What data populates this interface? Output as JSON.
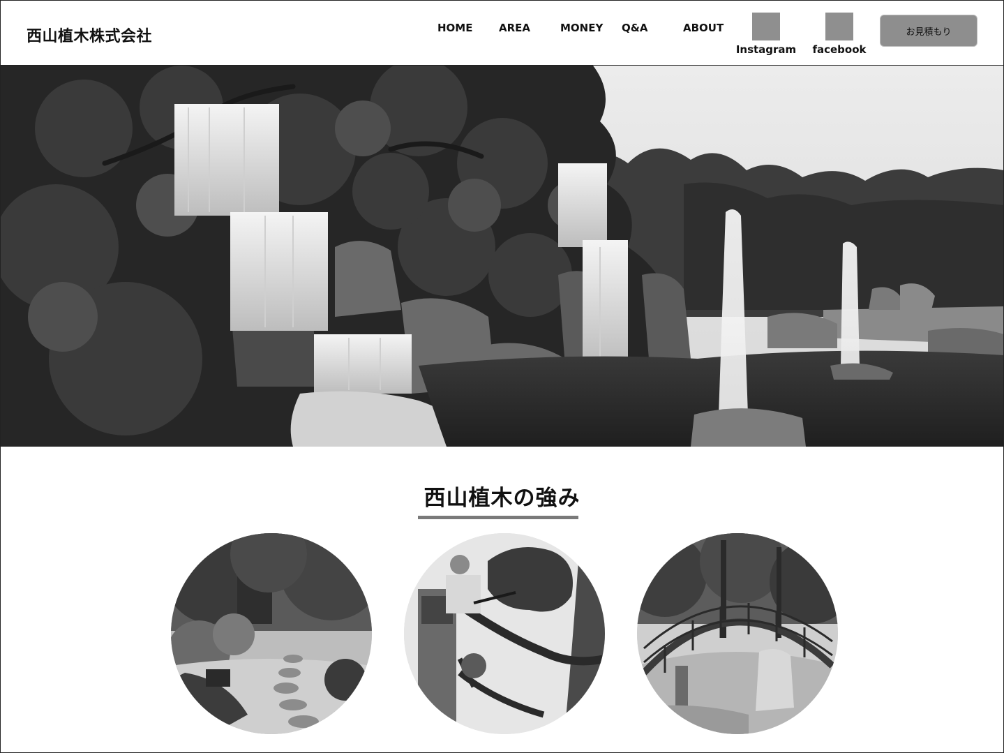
{
  "header": {
    "brand": "西山植木株式会社",
    "nav": [
      {
        "label": "HOME"
      },
      {
        "label": "AREA"
      },
      {
        "label": "MONEY"
      },
      {
        "label": "Q&A"
      },
      {
        "label": "ABOUT"
      }
    ],
    "social": [
      {
        "label": "Instagram",
        "icon": "instagram-icon"
      },
      {
        "label": "facebook",
        "icon": "facebook-icon"
      }
    ],
    "quote_button": "お見積もり"
  },
  "strengths": {
    "title": "西山植木の強み"
  },
  "colors": {
    "header_border": "#222222",
    "icon_placeholder": "#8f8f8f",
    "button_bg": "#8e8e8e",
    "underline": "#7a7a7a"
  }
}
